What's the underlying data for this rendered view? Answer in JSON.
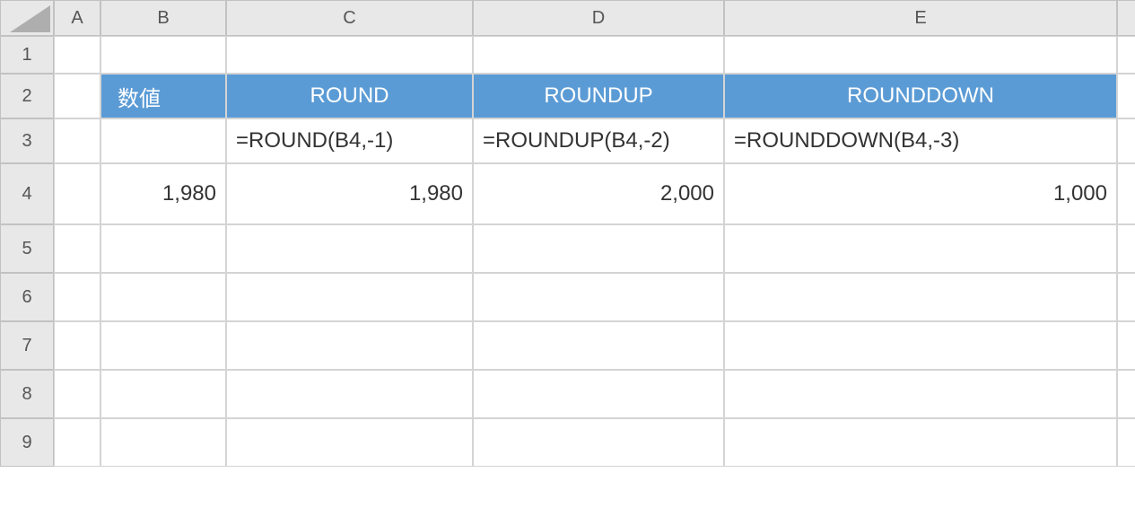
{
  "columns": [
    "A",
    "B",
    "C",
    "D",
    "E"
  ],
  "rows": [
    "1",
    "2",
    "3",
    "4",
    "5",
    "6",
    "7",
    "8",
    "9"
  ],
  "grid": {
    "B2": "数値",
    "C2": "ROUND",
    "D2": "ROUNDUP",
    "E2": "ROUNDDOWN",
    "C3": "=ROUND(B4,-1)",
    "D3": "=ROUNDUP(B4,-2)",
    "E3": "=ROUNDDOWN(B4,-3)",
    "B4": "1,980",
    "C4": "1,980",
    "D4": "2,000",
    "E4": "1,000"
  }
}
